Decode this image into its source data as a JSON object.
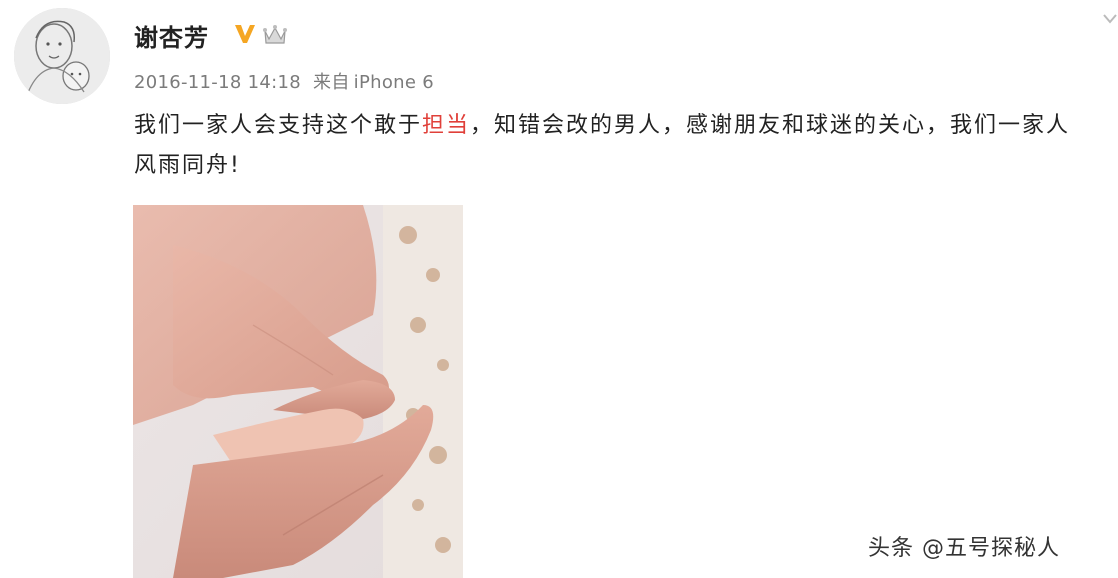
{
  "post": {
    "author": "谢杏芳",
    "timestamp": "2016-11-18 14:18",
    "source_prefix": "来自",
    "source_device": "iPhone 6",
    "text_before": "我们一家人会支持这个敢于",
    "text_highlight": "担当",
    "text_after": "，知错会改的男人，感谢朋友和球迷的关心，我们一家人风雨同舟!"
  },
  "icons": {
    "verified": "verified-v-icon",
    "member": "crown-member-icon",
    "corner": "chevron-down-icon"
  },
  "colors": {
    "highlight": "#e0403a",
    "verified": "#f5a623",
    "meta": "#7b7b7b"
  },
  "watermark": "头条 @五号探秘人"
}
